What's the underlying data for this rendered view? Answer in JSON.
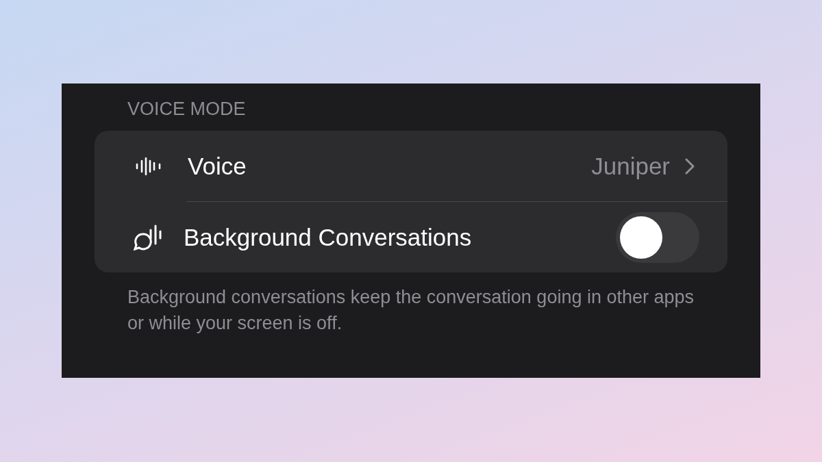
{
  "section": {
    "header": "VOICE MODE",
    "rows": [
      {
        "kind": "link",
        "label": "Voice",
        "value": "Juniper"
      },
      {
        "kind": "toggle",
        "label": "Background Conversations",
        "on": false
      }
    ],
    "footer": "Background conversations keep the conversation going in other apps or while your screen is off."
  }
}
